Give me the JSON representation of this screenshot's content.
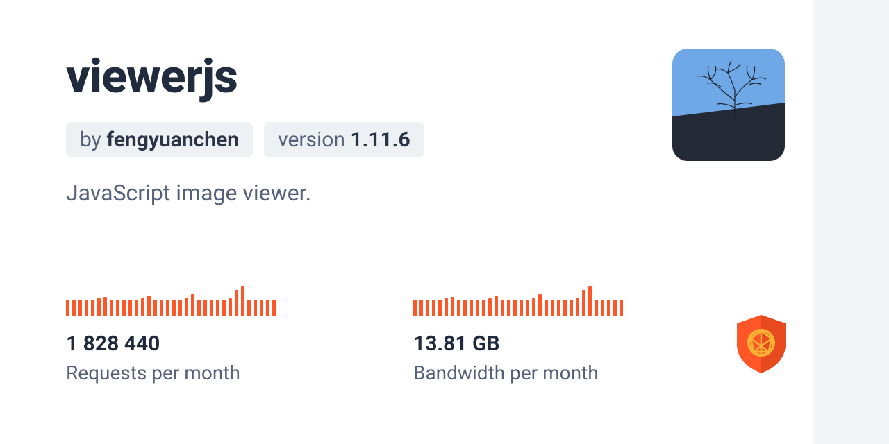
{
  "package": {
    "name": "viewerjs",
    "author_prefix": "by ",
    "author": "fengyuanchen",
    "version_prefix": "version ",
    "version": "1.11.6",
    "description": "JavaScript image viewer."
  },
  "stats": {
    "requests": {
      "value": "1 828 440",
      "label": "Requests per month",
      "spark": [
        24,
        24,
        24,
        24,
        24,
        26,
        28,
        24,
        24,
        24,
        24,
        24,
        26,
        30,
        24,
        24,
        24,
        24,
        24,
        26,
        32,
        24,
        24,
        24,
        24,
        24,
        26,
        38,
        44,
        24,
        24,
        24,
        24,
        24
      ]
    },
    "bandwidth": {
      "value": "13.81 GB",
      "label": "Bandwidth per month",
      "spark": [
        24,
        24,
        24,
        24,
        24,
        26,
        28,
        24,
        24,
        24,
        24,
        24,
        26,
        30,
        24,
        24,
        24,
        24,
        24,
        26,
        32,
        24,
        24,
        24,
        24,
        24,
        26,
        38,
        44,
        24,
        24,
        24,
        24,
        24
      ]
    }
  },
  "colors": {
    "accent": "#ff5627",
    "text_dark": "#202b3e",
    "text_muted": "#55607a",
    "pill_bg": "#eef1f4"
  }
}
